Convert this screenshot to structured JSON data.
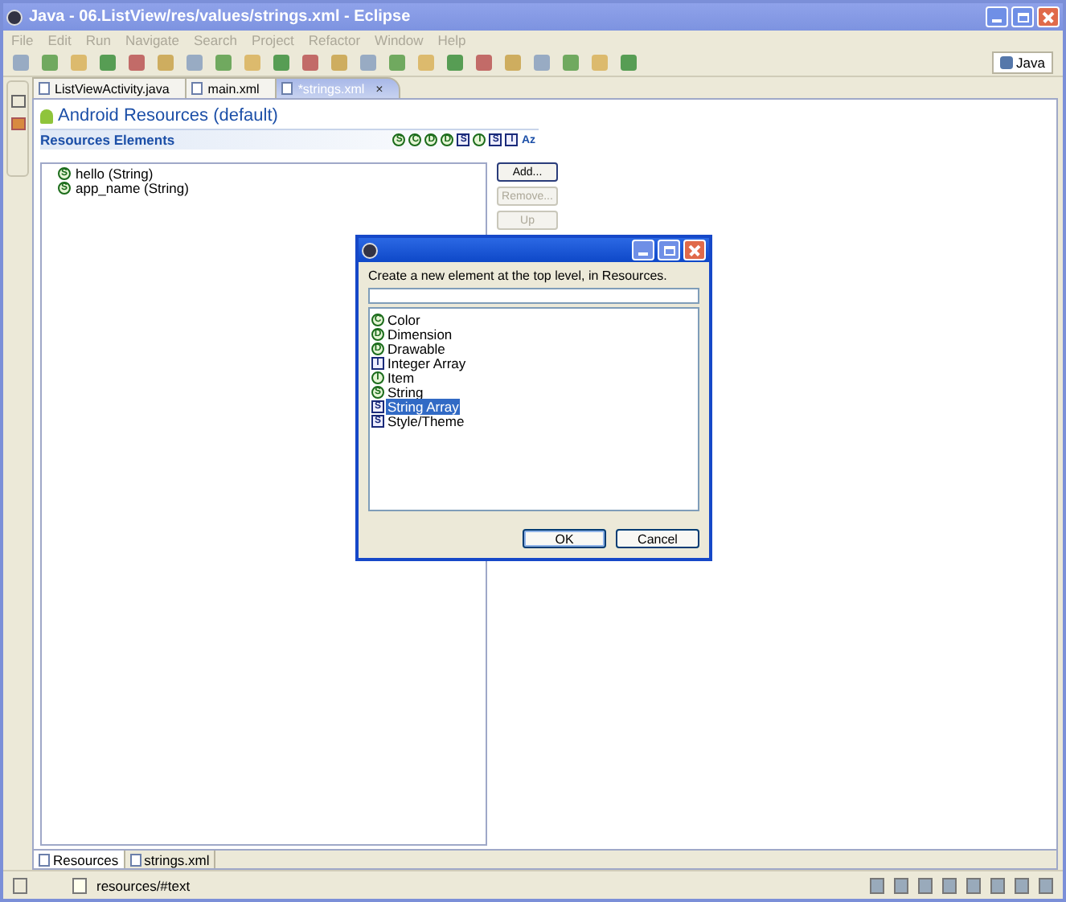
{
  "window": {
    "title": "Java - 06.ListView/res/values/strings.xml - Eclipse"
  },
  "menu": [
    {
      "label": "File",
      "disabled": true
    },
    {
      "label": "Edit",
      "disabled": true
    },
    {
      "label": "Run",
      "disabled": true
    },
    {
      "label": "Navigate",
      "disabled": true
    },
    {
      "label": "Search",
      "disabled": true
    },
    {
      "label": "Project",
      "disabled": true
    },
    {
      "label": "Refactor",
      "disabled": true
    },
    {
      "label": "Window",
      "disabled": true
    },
    {
      "label": "Help",
      "disabled": true
    }
  ],
  "perspective": {
    "label": "Java"
  },
  "editor_tabs": [
    {
      "label": "ListViewActivity.java",
      "selected": false
    },
    {
      "label": "main.xml",
      "selected": false
    },
    {
      "label": "*strings.xml",
      "selected": true,
      "close": "×"
    }
  ],
  "form": {
    "title": "Android Resources (default)",
    "section": "Resources Elements",
    "filters": [
      {
        "letter": "S",
        "kind": "circle"
      },
      {
        "letter": "C",
        "kind": "circle"
      },
      {
        "letter": "D",
        "kind": "circle"
      },
      {
        "letter": "D",
        "kind": "circle"
      },
      {
        "letter": "S",
        "kind": "square"
      },
      {
        "letter": "I",
        "kind": "circle"
      },
      {
        "letter": "S",
        "kind": "square"
      },
      {
        "letter": "I",
        "kind": "square"
      },
      {
        "letter": "Az",
        "kind": "text"
      }
    ],
    "tree": [
      {
        "icon": "S",
        "label": "hello (String)"
      },
      {
        "icon": "S",
        "label": "app_name (String)"
      }
    ],
    "buttons": [
      {
        "label": "Add...",
        "disabled": false
      },
      {
        "label": "Remove...",
        "disabled": true
      },
      {
        "label": "Up",
        "disabled": true
      }
    ]
  },
  "bottom_tabs": [
    {
      "label": "Resources",
      "selected": true
    },
    {
      "label": "strings.xml",
      "selected": false
    }
  ],
  "status_bar": {
    "text": "resources/#text"
  },
  "dialog": {
    "message": "Create a new element at the top level, in Resources.",
    "items": [
      {
        "icon": "C",
        "kind": "circle",
        "label": "Color",
        "selected": false
      },
      {
        "icon": "D",
        "kind": "circle",
        "label": "Dimension",
        "selected": false
      },
      {
        "icon": "D",
        "kind": "circle",
        "label": "Drawable",
        "selected": false
      },
      {
        "icon": "I",
        "kind": "square",
        "label": "Integer Array",
        "selected": false
      },
      {
        "icon": "I",
        "kind": "circle",
        "label": "Item",
        "selected": false
      },
      {
        "icon": "S",
        "kind": "circle",
        "label": "String",
        "selected": false
      },
      {
        "icon": "S",
        "kind": "square",
        "label": "String Array",
        "selected": true
      },
      {
        "icon": "S",
        "kind": "square",
        "label": "Style/Theme",
        "selected": false
      }
    ],
    "buttons": [
      "OK",
      "Cancel"
    ]
  }
}
